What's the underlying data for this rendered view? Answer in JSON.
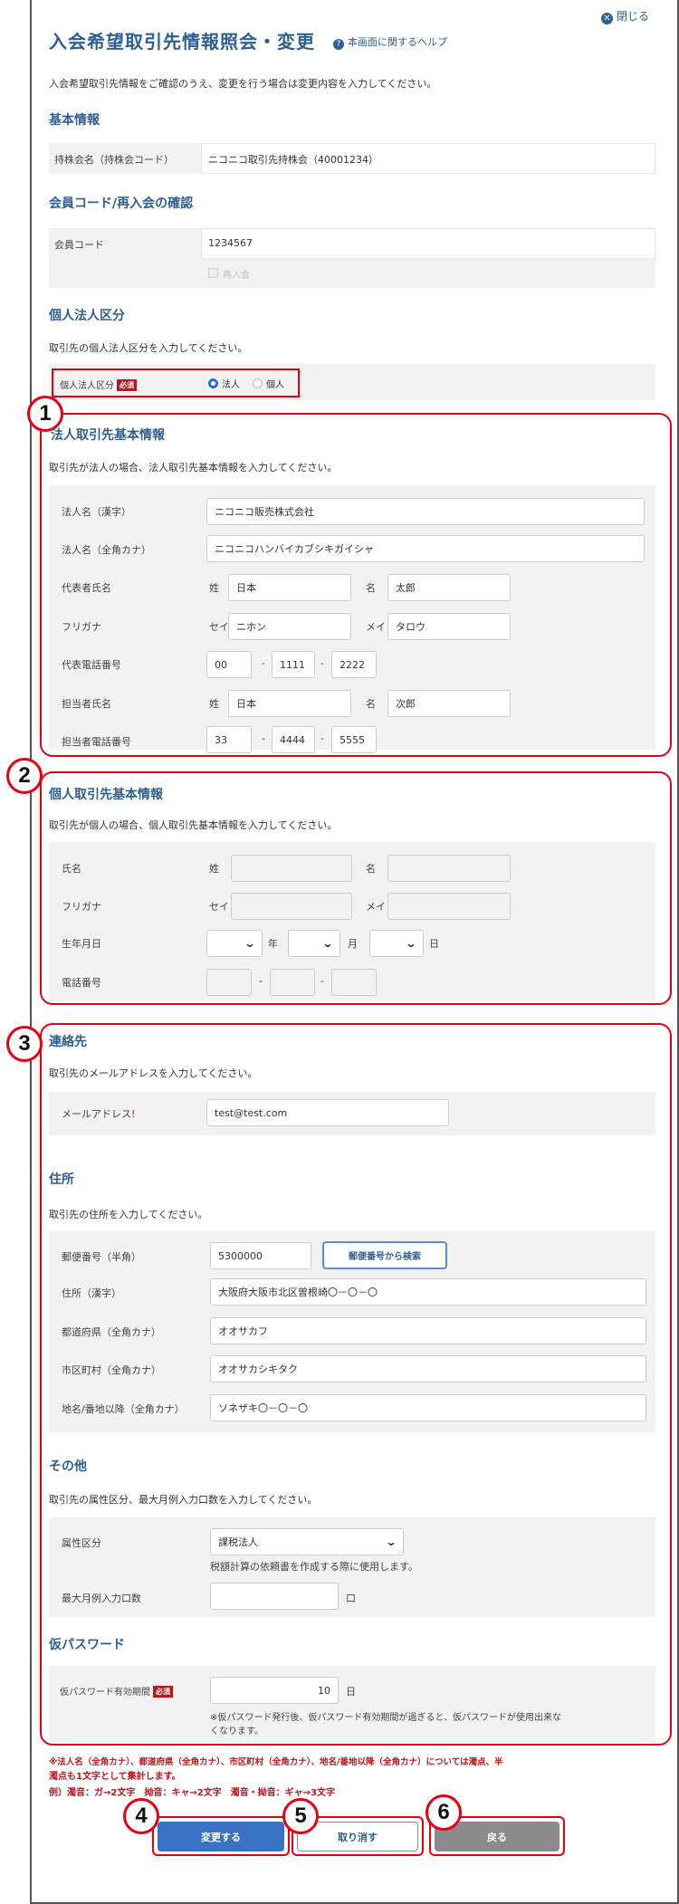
{
  "header": {
    "close_label": "閉じる",
    "title": "入会希望取引先情報照会・変更",
    "help_label": "本画面に関するヘルプ",
    "intro": "入会希望取引先情報をご確認のうえ、変更を行う場合は変更内容を入力してください。"
  },
  "basic": {
    "heading": "基本情報",
    "holding_label": "持株会名（持株会コード）",
    "holding_value": "ニコニコ取引先持株会（40001234）"
  },
  "member": {
    "heading": "会員コード/再入会の確認",
    "code_label": "会員コード",
    "code_value": "1234567",
    "rejoin_label": "再入会"
  },
  "kind": {
    "heading": "個人法人区分",
    "desc": "取引先の個人法人区分を入力してください。",
    "label": "個人法人区分",
    "required": "必須",
    "opt_corp": "法人",
    "opt_indiv": "個人"
  },
  "corp": {
    "heading": "法人取引先基本情報",
    "desc": "取引先が法人の場合、法人取引先基本情報を入力してください。",
    "name_kanji_label": "法人名（漢字）",
    "name_kanji": "ニコニコ販売株式会社",
    "name_kana_label": "法人名（全角カナ）",
    "name_kana": "ニコニコハンバイカブシキガイシャ",
    "rep_label": "代表者氏名",
    "sei": "姓",
    "mei": "名",
    "rep_last": "日本",
    "rep_first": "太郎",
    "furigana_label": "フリガナ",
    "sei_kana": "セイ",
    "mei_kana": "メイ",
    "rep_last_kana": "ニホン",
    "rep_first_kana": "タロウ",
    "rep_tel_label": "代表電話番号",
    "rep_tel": [
      "00",
      "1111",
      "2222"
    ],
    "staff_label": "担当者氏名",
    "staff_last": "日本",
    "staff_first": "次郎",
    "staff_tel_label": "担当者電話番号",
    "staff_tel": [
      "33",
      "4444",
      "5555"
    ],
    "dash": "-"
  },
  "indiv": {
    "heading": "個人取引先基本情報",
    "desc": "取引先が個人の場合、個人取引先基本情報を入力してください。",
    "name_label": "氏名",
    "furigana_label": "フリガナ",
    "birth_label": "生年月日",
    "year": "年",
    "month": "月",
    "day": "日",
    "tel_label": "電話番号"
  },
  "contact": {
    "heading": "連絡先",
    "desc": "取引先のメールアドレスを入力してください。",
    "email_label": "メールアドレス",
    "email": "test@test.com"
  },
  "address": {
    "heading": "住所",
    "desc": "取引先の住所を入力してください。",
    "zip_label": "郵便番号（半角）",
    "zip": "5300000",
    "zip_search": "郵便番号から検索",
    "addr_label": "住所（漢字）",
    "addr": "大阪府大阪市北区曽根崎〇－〇－〇",
    "pref_label": "都道府県（全角カナ）",
    "pref": "オオサカフ",
    "city_label": "市区町村（全角カナ）",
    "city": "オオサカシキタク",
    "area_label": "地名/番地以降（全角カナ）",
    "area": "ソネザキ〇－〇－〇"
  },
  "other": {
    "heading": "その他",
    "desc": "取引先の属性区分、最大月例入力口数を入力してください。",
    "attr_label": "属性区分",
    "attr_value": "課税法人",
    "attr_note": "税額計算の依頼書を作成する際に使用します。",
    "max_label": "最大月例入力口数",
    "max_unit": "口"
  },
  "temp": {
    "heading": "仮パスワード",
    "period_label": "仮パスワード有効期間",
    "required": "必須",
    "period_value": "10",
    "period_unit": "日",
    "note1": "※仮パスワード発行後、仮パスワード有効期間が過ぎると、仮パスワードが使用出来な",
    "note2": "くなります。"
  },
  "notes": {
    "line1": "※法人名（全角カナ）、都道府県（全角カナ）、市区町村（全角カナ）、地名/番地以降（全角カナ）については濁点、半",
    "line2": "濁点も1文字として集計します。",
    "line3": "例）濁音：ガ→2文字　拗音：キャ→2文字　濁音・拗音：ギャ→3文字"
  },
  "buttons": {
    "change": "変更する",
    "cancel": "取り消す",
    "back": "戻る"
  },
  "markers": [
    "1",
    "2",
    "3",
    "4",
    "5",
    "6"
  ],
  "colors": {
    "accent": "#2e5f92",
    "button_blue": "#3a72c4",
    "annotation_red": "#e60012",
    "required_red": "#c0141c",
    "panel_gray": "#f2f2f2"
  }
}
